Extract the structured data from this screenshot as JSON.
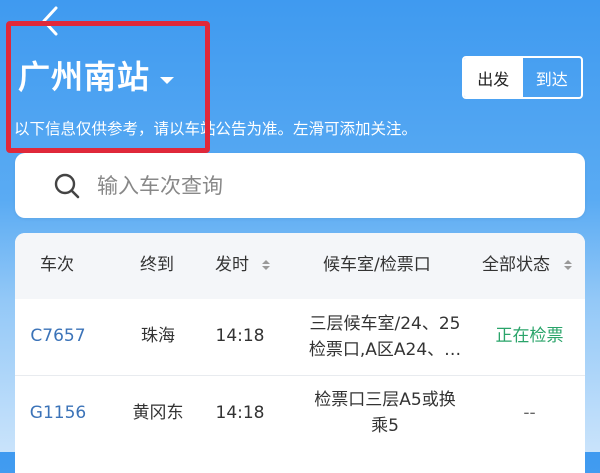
{
  "header": {
    "back_label": "<",
    "station_name": "广州南站",
    "notice": "以下信息仅供参考，请以车站公告为准。左滑可添加关注。"
  },
  "toggle": {
    "departure_label": "出发",
    "arrival_label": "到达",
    "active": "departure"
  },
  "search": {
    "placeholder": "输入车次查询"
  },
  "table": {
    "columns": {
      "train": "车次",
      "terminal": "终到",
      "depart_time": "发时",
      "waiting_room": "候车室/检票口",
      "status": "全部状态"
    },
    "rows": [
      {
        "train": "C7657",
        "terminal": "珠海",
        "time": "14:18",
        "room_line1": "三层候车室/24、25",
        "room_line2": "检票口,A区A24、…",
        "status": "正在检票"
      },
      {
        "train": "G1156",
        "terminal": "黄冈东",
        "time": "14:18",
        "room_line1": "检票口三层A5或换",
        "room_line2": "乘5",
        "status": "--"
      }
    ]
  },
  "colors": {
    "header_blue": "#3f9af0",
    "highlight_frame": "#e0283a",
    "train_link": "#3b73b8",
    "status_checking": "#2aa46a"
  }
}
